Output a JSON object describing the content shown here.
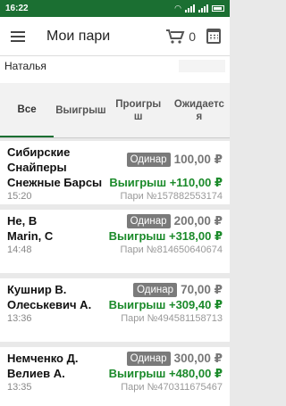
{
  "status": {
    "time": "16:22"
  },
  "header": {
    "title": "Мои пари",
    "cart_count": "0"
  },
  "user": {
    "name": "Наталья"
  },
  "tabs": [
    {
      "label": "Все"
    },
    {
      "label": "Выигрыш"
    },
    {
      "label": "Проигрыш"
    },
    {
      "label": "Ожидается"
    }
  ],
  "bets": [
    {
      "team1": "Сибирские Снайперы",
      "team2": "Снежные Барсы",
      "type": "Одинар",
      "stake": "100,00 ₽",
      "result": "Выигрыш +110,00 ₽",
      "time": "15:20",
      "bet_no": "Пари №157882553174"
    },
    {
      "team1": "Не, В",
      "team2": "Marin, C",
      "type": "Одинар",
      "stake": "200,00 ₽",
      "result": "Выигрыш +318,00 ₽",
      "time": "14:48",
      "bet_no": "Пари №814650640674"
    },
    {
      "team1": "Кушнир В.",
      "team2": "Олеськевич А.",
      "type": "Одинар",
      "stake": "70,00 ₽",
      "result": "Выигрыш +309,40 ₽",
      "time": "13:36",
      "bet_no": "Пари №494581158713"
    },
    {
      "team1": "Немченко Д.",
      "team2": "Велиев А.",
      "type": "Одинар",
      "stake": "300,00 ₽",
      "result": "Выигрыш +480,00 ₽",
      "time": "13:35",
      "bet_no": "Пари №470311675467"
    }
  ]
}
